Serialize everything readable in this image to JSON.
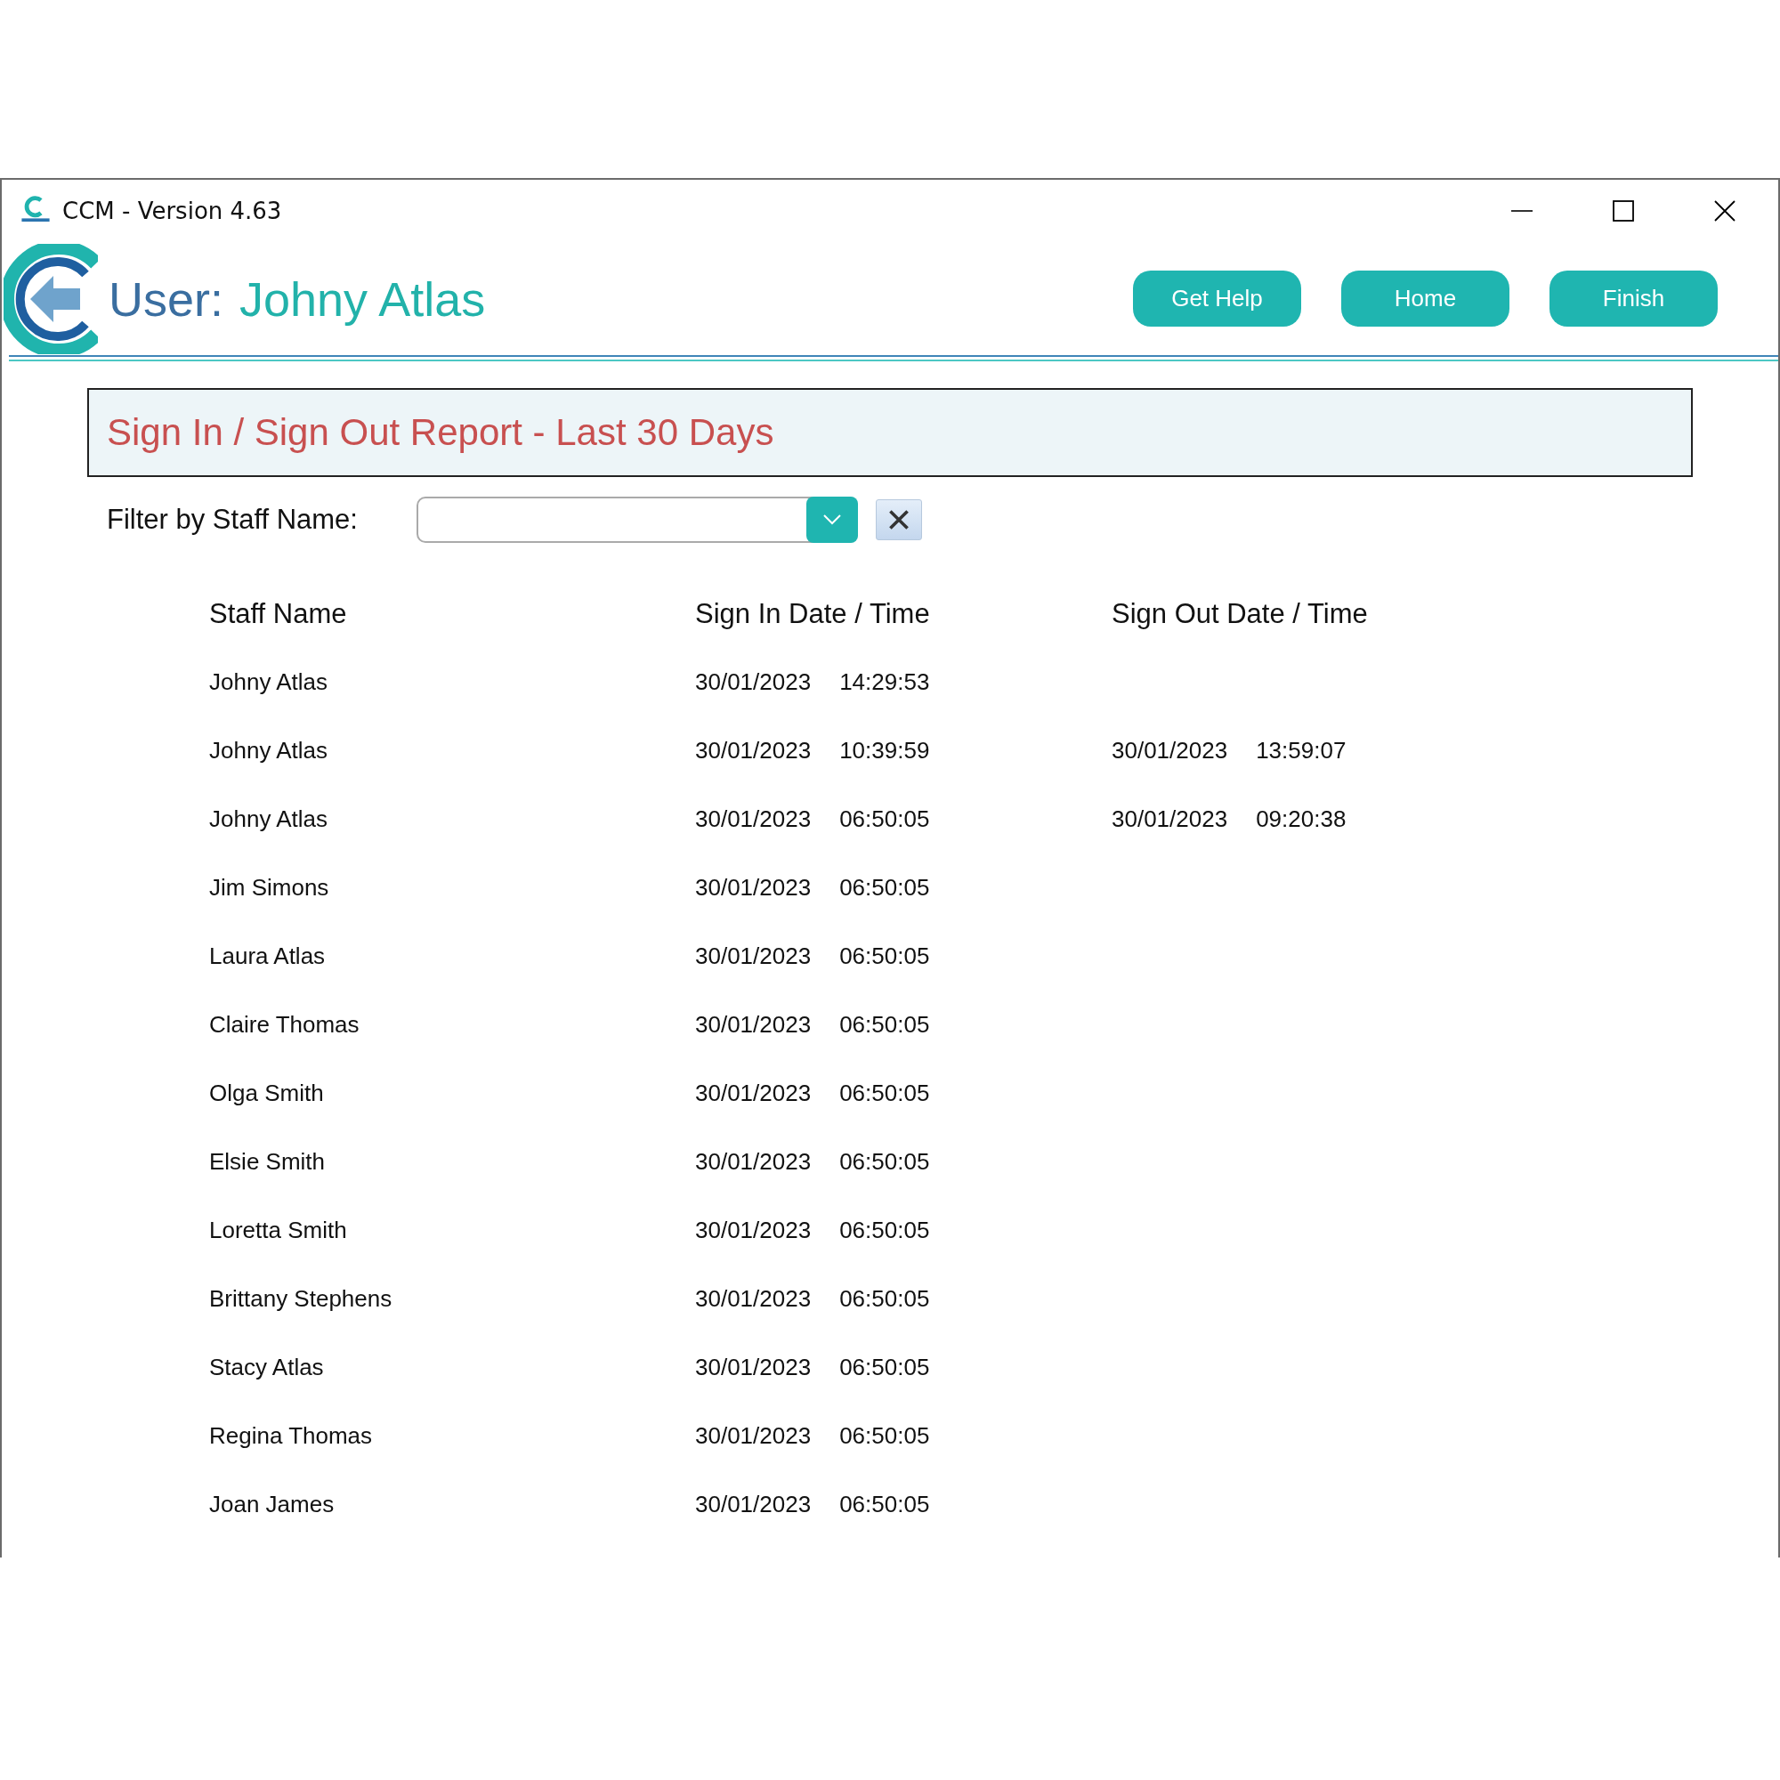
{
  "window": {
    "title": "CCM - Version 4.63"
  },
  "header": {
    "user_label": "User:",
    "user_name": "Johny Atlas",
    "buttons": [
      "Get Help",
      "Home",
      "Finish"
    ]
  },
  "report_title": "Sign In / Sign Out Report - Last 30 Days",
  "filter": {
    "label": "Filter by Staff Name:"
  },
  "table": {
    "columns": [
      "Staff Name",
      "Sign In Date / Time",
      "Sign Out Date / Time"
    ],
    "rows": [
      {
        "name": "Johny Atlas",
        "sign_in": {
          "date": "30/01/2023",
          "time": "14:29:53"
        }
      },
      {
        "name": "Johny Atlas",
        "sign_in": {
          "date": "30/01/2023",
          "time": "10:39:59"
        },
        "sign_out": {
          "date": "30/01/2023",
          "time": "13:59:07"
        }
      },
      {
        "name": "Johny Atlas",
        "sign_in": {
          "date": "30/01/2023",
          "time": "06:50:05"
        },
        "sign_out": {
          "date": "30/01/2023",
          "time": "09:20:38"
        }
      },
      {
        "name": "Jim Simons",
        "sign_in": {
          "date": "30/01/2023",
          "time": "06:50:05"
        }
      },
      {
        "name": "Laura Atlas",
        "sign_in": {
          "date": "30/01/2023",
          "time": "06:50:05"
        }
      },
      {
        "name": "Claire Thomas",
        "sign_in": {
          "date": "30/01/2023",
          "time": "06:50:05"
        }
      },
      {
        "name": "Olga Smith",
        "sign_in": {
          "date": "30/01/2023",
          "time": "06:50:05"
        }
      },
      {
        "name": "Elsie Smith",
        "sign_in": {
          "date": "30/01/2023",
          "time": "06:50:05"
        }
      },
      {
        "name": "Loretta Smith",
        "sign_in": {
          "date": "30/01/2023",
          "time": "06:50:05"
        }
      },
      {
        "name": "Brittany Stephens",
        "sign_in": {
          "date": "30/01/2023",
          "time": "06:50:05"
        }
      },
      {
        "name": "Stacy Atlas",
        "sign_in": {
          "date": "30/01/2023",
          "time": "06:50:05"
        }
      },
      {
        "name": "Regina Thomas",
        "sign_in": {
          "date": "30/01/2023",
          "time": "06:50:05"
        }
      },
      {
        "name": "Joan James",
        "sign_in": {
          "date": "30/01/2023",
          "time": "06:50:05"
        }
      }
    ]
  }
}
